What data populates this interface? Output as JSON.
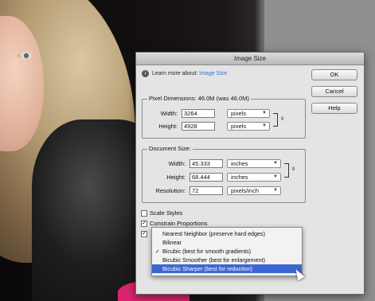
{
  "dialog": {
    "title": "Image Size",
    "learn_prefix": "Learn more about:",
    "learn_link": "Image Size"
  },
  "buttons": {
    "ok": "OK",
    "cancel": "Cancel",
    "help": "Help"
  },
  "pixel_dimensions": {
    "legend": "Pixel Dimensions:  46.0M (was 46.0M)",
    "width_label": "Width:",
    "width_value": "3264",
    "width_unit": "pixels",
    "height_label": "Height:",
    "height_value": "4928",
    "height_unit": "pixels"
  },
  "document_size": {
    "legend": "Document Size:",
    "width_label": "Width:",
    "width_value": "45.333",
    "width_unit": "inches",
    "height_label": "Height:",
    "height_value": "68.444",
    "height_unit": "inches",
    "resolution_label": "Resolution:",
    "resolution_value": "72",
    "resolution_unit": "pixels/inch"
  },
  "checkboxes": {
    "scale_styles": "Scale Styles",
    "constrain": "Constrain Proportions"
  },
  "resample_menu": {
    "items": [
      "Nearest Neighbor (preserve hard edges)",
      "Bilinear",
      "Bicubic (best for smooth gradients)",
      "Bicubic Smoother (best for enlargement)",
      "Bicubic Sharper (best for reduction)"
    ],
    "checked_index": 2,
    "highlighted_index": 4
  }
}
